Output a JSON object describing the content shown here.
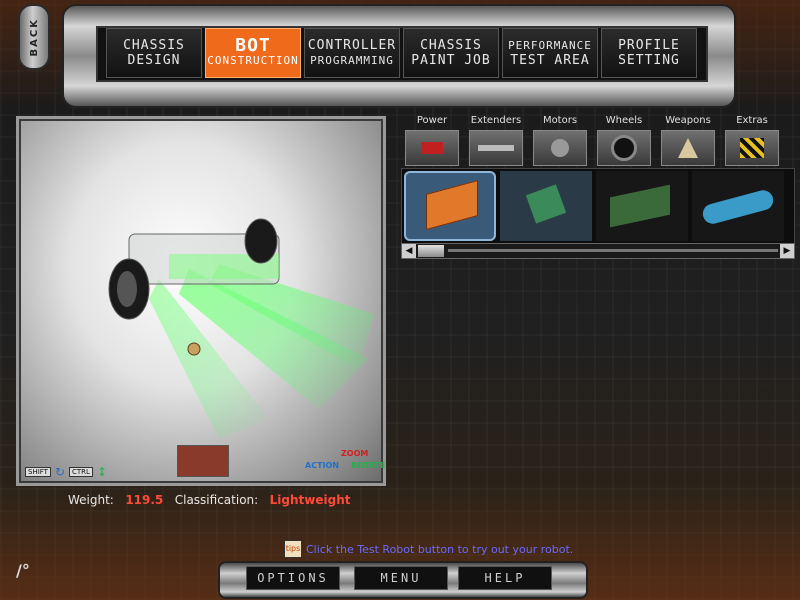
{
  "back": {
    "label": "BACK"
  },
  "nav": {
    "tabs": [
      {
        "line1": "CHASSIS",
        "line2": "DESIGN"
      },
      {
        "line1": "BOT",
        "line2": "CONSTRUCTION"
      },
      {
        "line1": "CONTROLLER",
        "line2": "PROGRAMMING"
      },
      {
        "line1": "CHASSIS",
        "line2": "PAINT JOB"
      },
      {
        "line1": "PERFORMANCE",
        "line2": "TEST AREA"
      },
      {
        "line1": "PROFILE",
        "line2": "SETTING"
      }
    ],
    "active_tab": "BOT CONSTRUCTION"
  },
  "viewport": {
    "keys": {
      "shift": "SHIFT",
      "ctrl": "CTRL"
    },
    "controls": {
      "zoom": "ZOOM",
      "action": "ACTION",
      "rotate": "ROTATE"
    }
  },
  "stats": {
    "weight_label": "Weight:",
    "weight_value": "119.5",
    "class_label": "Classification:",
    "class_value": "Lightweight"
  },
  "parts": {
    "categories": [
      {
        "label": "Power",
        "icon": "battery-icon"
      },
      {
        "label": "Extenders",
        "icon": "extender-bar-icon"
      },
      {
        "label": "Motors",
        "icon": "motor-icon"
      },
      {
        "label": "Wheels",
        "icon": "wheel-icon"
      },
      {
        "label": "Weapons",
        "icon": "weapon-icon"
      },
      {
        "label": "Extras",
        "icon": "hazard-icon"
      }
    ],
    "items": [
      {
        "name": "orange-circuit-board",
        "selected": true
      },
      {
        "name": "green-circuit-board",
        "selected": false
      },
      {
        "name": "green-controller-board",
        "selected": false
      },
      {
        "name": "blue-canister",
        "selected": false
      }
    ]
  },
  "tip": {
    "icon_text": "tips",
    "text": "Click the Test Robot button to try out your robot."
  },
  "bottom": {
    "options": "OPTIONS",
    "menu": "MENU",
    "help": "HELP"
  },
  "colors": {
    "accent": "#f06a1c",
    "stat_value": "#ff4a3a",
    "tip_text": "#6a6aff",
    "glow": "#33ff55"
  }
}
